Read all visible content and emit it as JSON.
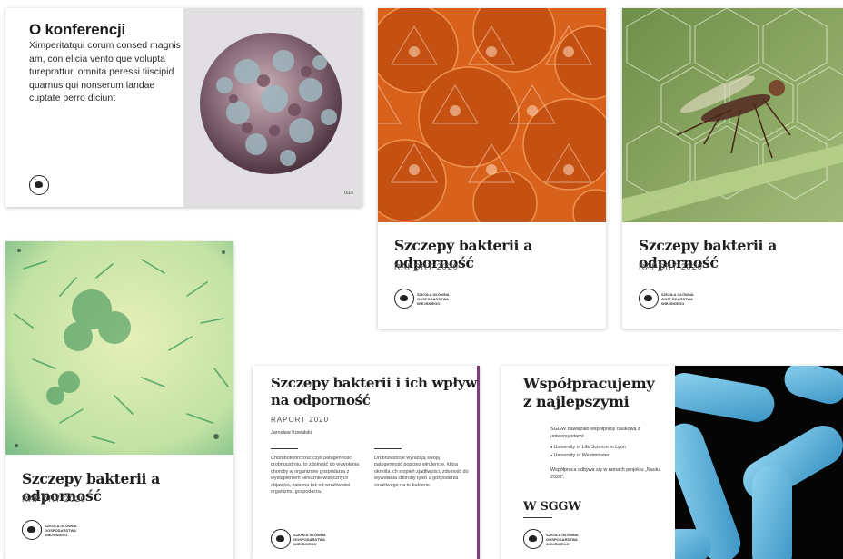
{
  "conference": {
    "heading": "O konferencji",
    "body": "Ximperitatqui corum consed magnis am, con elicia vento que volupta tureprattur, omnita peressi tiiscipid quamus qui nonserum landae cuptate perro diciunt",
    "page_number": "0/15"
  },
  "report_orange": {
    "title": "Szczepy bakterii a odporność",
    "subtitle": "RAPORT 2020"
  },
  "report_insect": {
    "title": "Szczepy bakterii a odporność",
    "subtitle": "RAPORT 2020"
  },
  "report_green": {
    "title": "Szczepy bakterii a odporność",
    "subtitle": "RAPORT 2020"
  },
  "logo": {
    "text": "SZKOŁA GŁÓWNA\nGOSPODARSTWA\nWIEJSKIEGO"
  },
  "report_detail": {
    "title_line1": "Szczepy bakterii i ich wpływ",
    "title_line2": "na odporność",
    "subtitle": "RAPORT 2020",
    "author": "Jarosław Kowalski",
    "col1": "Chorobotwórczość czyli patogenność drobnoustroju, to zdolność do wywołania choroby w organizmie gospodarza z wystąpieniem klinicznie widocznych objawów, zależna też od wrażliwości organizmu gospodarza.",
    "col2": "Drobnoustroje wyrażają swoją patogenność poprzez wirulencję, która określa ich stopień zjadliwości, zdolność do wywołania choroby tylko u gospodarza wrażliwego na te bakterie."
  },
  "cooperation": {
    "title_line1": "Współpracujemy",
    "title_line2": "z najlepszymi",
    "intro": "SGGW nawiązało współpracę naukową z uniwersytetami:",
    "partners": [
      "University of Life Science in Lyon",
      "University of Westminster"
    ],
    "note": "Współpraca odbywa się w ramach projektu „Nauka 2020\".",
    "section": "W SGGW"
  },
  "colors": {
    "orange": "#d8621c",
    "insect_green": "#8aa860",
    "microscope_green": "#b9dba0",
    "bacteria_blue": "#5fb8e0"
  }
}
